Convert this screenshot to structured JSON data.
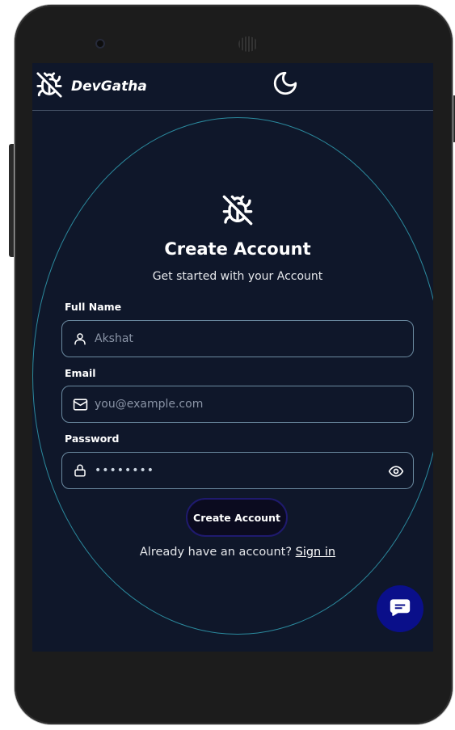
{
  "brand": {
    "name": "DevGatha",
    "logo_icon": "bug-off-icon"
  },
  "navbar": {
    "theme_toggle_icon": "moon-icon"
  },
  "form": {
    "logo_icon": "bug-off-icon",
    "title": "Create Account",
    "subtitle": "Get started with your Account",
    "full_name": {
      "label": "Full Name",
      "placeholder": "Akshat",
      "icon": "user-icon"
    },
    "email": {
      "label": "Email",
      "placeholder": "you@example.com",
      "icon": "mail-icon"
    },
    "password": {
      "label": "Password",
      "value": "••••••••",
      "icon": "lock-icon",
      "toggle_icon": "eye-icon"
    },
    "submit_label": "Create Account",
    "signin_prompt": "Already have an account?",
    "signin_link": "Sign in"
  },
  "chat_fab": {
    "icon": "chat-bubble-icon"
  },
  "colors": {
    "background": "#0f172a",
    "circle_border": "#2b8a9e",
    "field_border": "#6b8aa0",
    "fab": "#0a0f8a",
    "button_border": "#1f1a6e"
  }
}
